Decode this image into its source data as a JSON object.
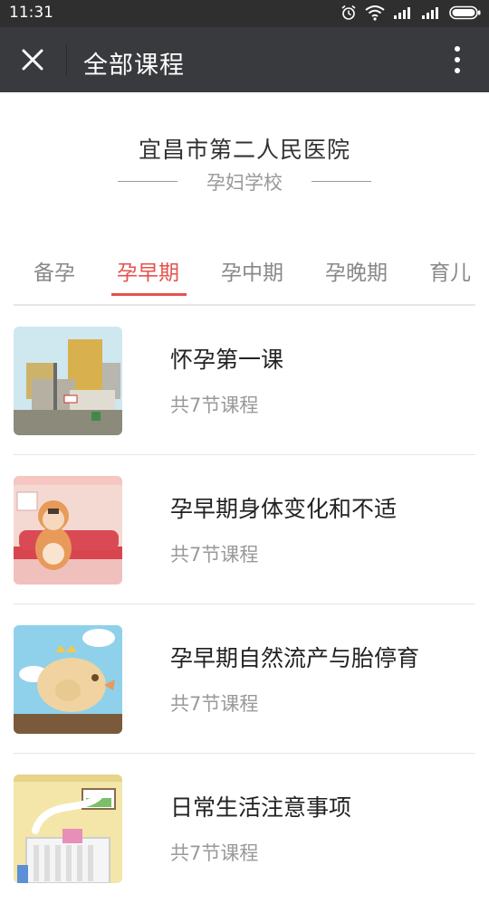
{
  "status_bar": {
    "time": "11:31"
  },
  "app_bar": {
    "title": "全部课程"
  },
  "header": {
    "hospital": "宜昌市第二人民医院",
    "school": "孕妇学校"
  },
  "tabs": [
    {
      "label": "备孕",
      "active": false
    },
    {
      "label": "孕早期",
      "active": true
    },
    {
      "label": "孕中期",
      "active": false
    },
    {
      "label": "孕晚期",
      "active": false
    },
    {
      "label": "育儿",
      "active": false
    }
  ],
  "courses": [
    {
      "title": "怀孕第一课",
      "count": "共7节课程",
      "thumbnail": "city-street-illustration"
    },
    {
      "title": "孕早期身体变化和不适",
      "count": "共7节课程",
      "thumbnail": "pregnant-woman-sofa-illustration"
    },
    {
      "title": "孕早期自然流产与胎停育",
      "count": "共7节课程",
      "thumbnail": "fish-cloud-illustration"
    },
    {
      "title": "日常生活注意事项",
      "count": "共7节课程",
      "thumbnail": "room-heater-illustration"
    }
  ],
  "colors": {
    "accent": "#e5514e",
    "app_bar": "#393a3e",
    "status_bar": "#2f2f2f"
  }
}
